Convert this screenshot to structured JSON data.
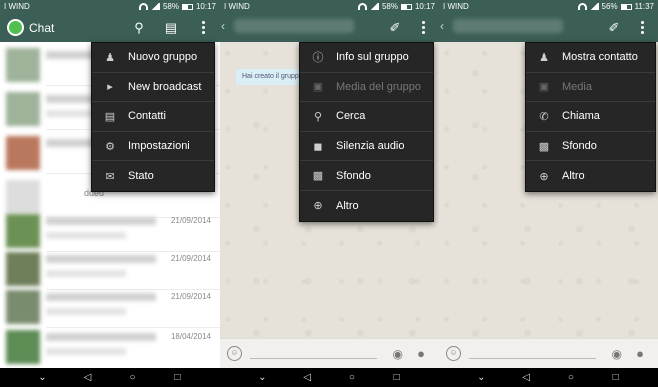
{
  "status_bars": [
    {
      "carrier": "I WIND",
      "battery": "58%",
      "time": "10:17"
    },
    {
      "carrier": "I WIND",
      "battery": "58%",
      "time": "10:17"
    },
    {
      "carrier": "I WIND",
      "battery": "56%",
      "time": "11:37"
    }
  ],
  "panel1": {
    "title": "Chat",
    "menu": [
      {
        "label": "Nuovo gruppo",
        "icon": "group-icon"
      },
      {
        "label": "New broadcast",
        "icon": "broadcast-icon"
      },
      {
        "label": "Contatti",
        "icon": "contacts-icon"
      },
      {
        "label": "Impostazioni",
        "icon": "settings-icon"
      },
      {
        "label": "Stato",
        "icon": "status-icon"
      }
    ],
    "chats": [
      {
        "date": ""
      },
      {
        "date": ""
      },
      {
        "date": ""
      },
      {
        "date": ""
      },
      {
        "date": "21/09/2014"
      },
      {
        "date": "21/09/2014"
      },
      {
        "date": "21/09/2014"
      },
      {
        "date": "18/04/2014"
      }
    ],
    "partial_text": "dded"
  },
  "panel2": {
    "system_message": "Hai creato il grupp",
    "menu": [
      {
        "label": "Info sul gruppo",
        "icon": "info-icon",
        "enabled": true
      },
      {
        "label": "Media del gruppo",
        "icon": "image-icon",
        "enabled": false
      },
      {
        "label": "Cerca",
        "icon": "search-icon",
        "enabled": true
      },
      {
        "label": "Silenzia audio",
        "icon": "mute-icon",
        "enabled": true
      },
      {
        "label": "Sfondo",
        "icon": "wallpaper-icon",
        "enabled": true
      },
      {
        "label": "Altro",
        "icon": "more-icon",
        "enabled": true
      }
    ]
  },
  "panel3": {
    "menu": [
      {
        "label": "Mostra contatto",
        "icon": "contact-icon",
        "enabled": true
      },
      {
        "label": "Media",
        "icon": "image-icon",
        "enabled": false
      },
      {
        "label": "Chiama",
        "icon": "phone-icon",
        "enabled": true
      },
      {
        "label": "Sfondo",
        "icon": "wallpaper-icon",
        "enabled": true
      },
      {
        "label": "Altro",
        "icon": "more-icon",
        "enabled": true
      }
    ]
  },
  "colors": {
    "toolbar": "#3b5f57",
    "menu_bg": "#262626",
    "accent": "#4fc04e"
  }
}
